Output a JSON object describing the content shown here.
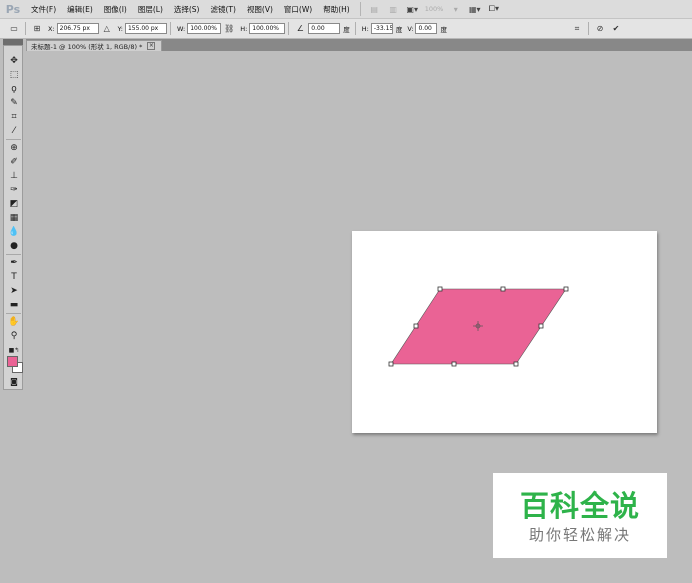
{
  "app": {
    "logo": "Ps"
  },
  "menu": [
    {
      "id": "file",
      "label": "文件(F)"
    },
    {
      "id": "edit",
      "label": "编辑(E)"
    },
    {
      "id": "image",
      "label": "图像(I)"
    },
    {
      "id": "layer",
      "label": "图层(L)"
    },
    {
      "id": "select",
      "label": "选择(S)"
    },
    {
      "id": "filter",
      "label": "滤镜(T)"
    },
    {
      "id": "view",
      "label": "视图(V)"
    },
    {
      "id": "window",
      "label": "窗口(W)"
    },
    {
      "id": "help",
      "label": "帮助(H)"
    }
  ],
  "zoom_display": "100%",
  "options": {
    "x_label": "X:",
    "x_value": "206.75 px",
    "y_label": "Y:",
    "y_value": "155.00 px",
    "w_label": "W:",
    "w_value": "100.00%",
    "h_label": "H:",
    "h_value": "100.00%",
    "angle_value": "0.00",
    "angle_unit": "度",
    "hskew_label": "H:",
    "hskew_value": "-33.15",
    "hskew_unit": "度",
    "vskew_label": "V:",
    "vskew_value": "0.00",
    "vskew_unit": "度"
  },
  "document": {
    "tab_title": "未标题-1 @ 100% (形状 1, RGB/8) *",
    "close_glyph": "×"
  },
  "colors": {
    "foreground": "#ea6395",
    "background": "#ffffff",
    "shape_fill": "#ea6395"
  },
  "watermark": {
    "title": "百科全说",
    "subtitle": "助你轻松解决"
  }
}
